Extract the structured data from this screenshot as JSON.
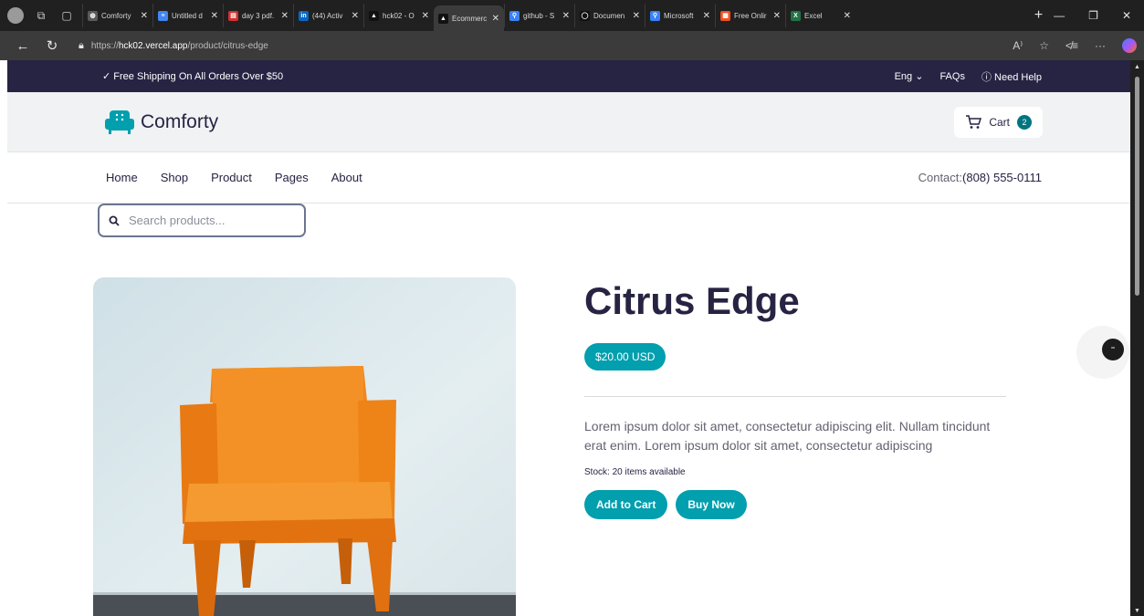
{
  "browser": {
    "tabs": [
      {
        "title": "Comforty",
        "icon": "globe-icon",
        "color": "#5a5a5a",
        "glyph": "◍"
      },
      {
        "title": "Untitled d",
        "icon": "docs-icon",
        "color": "#4285f4",
        "glyph": "≡"
      },
      {
        "title": "day 3 pdf.",
        "icon": "pdf-icon",
        "color": "#d32f2f",
        "glyph": "▤"
      },
      {
        "title": "(44) Activ",
        "icon": "linkedin-icon",
        "color": "#0a66c2",
        "glyph": "in"
      },
      {
        "title": "hck02 - O",
        "icon": "vercel-icon",
        "color": "#111111",
        "glyph": "▲"
      },
      {
        "title": "Ecommerc",
        "icon": "vercel-icon",
        "color": "#111111",
        "glyph": "▲",
        "active": true
      },
      {
        "title": "github - S",
        "icon": "search-icon",
        "color": "#3b82f6",
        "glyph": "⚲"
      },
      {
        "title": "Documen",
        "icon": "github-icon",
        "color": "#111111",
        "glyph": "◯"
      },
      {
        "title": "Microsoft",
        "icon": "search-icon",
        "color": "#3b82f6",
        "glyph": "⚲"
      },
      {
        "title": "Free Onlir",
        "icon": "microsoft-icon",
        "color": "#f25022",
        "glyph": "▦"
      },
      {
        "title": "Excel",
        "icon": "excel-icon",
        "color": "#217346",
        "glyph": "X"
      }
    ],
    "url_prefix": "https://",
    "url_host": "hck02.vercel.app",
    "url_path": "/product/citrus-edge"
  },
  "topbar": {
    "shipping": "✓ Free Shipping On All Orders Over $50",
    "language": "Eng",
    "faqs": "FAQs",
    "help": "Need Help"
  },
  "brand": {
    "name": "Comforty",
    "cart_label": "Cart",
    "cart_count": "2",
    "accent": "#029fae",
    "dark": "#272343"
  },
  "nav": {
    "links": [
      "Home",
      "Shop",
      "Product",
      "Pages",
      "About"
    ],
    "contact_label": "Contact:",
    "contact_phone": "(808) 555-0111"
  },
  "search": {
    "placeholder": "Search products..."
  },
  "product": {
    "title": "Citrus Edge",
    "price": "$20.00 USD",
    "description": "Lorem ipsum dolor sit amet, consectetur adipiscing elit. Nullam tincidunt erat enim. Lorem ipsum dolor sit amet, consectetur adipiscing",
    "stock": "Stock: 20 items available",
    "add_to_cart": "Add to Cart",
    "buy_now": "Buy Now",
    "image": "orange-chair-image"
  }
}
